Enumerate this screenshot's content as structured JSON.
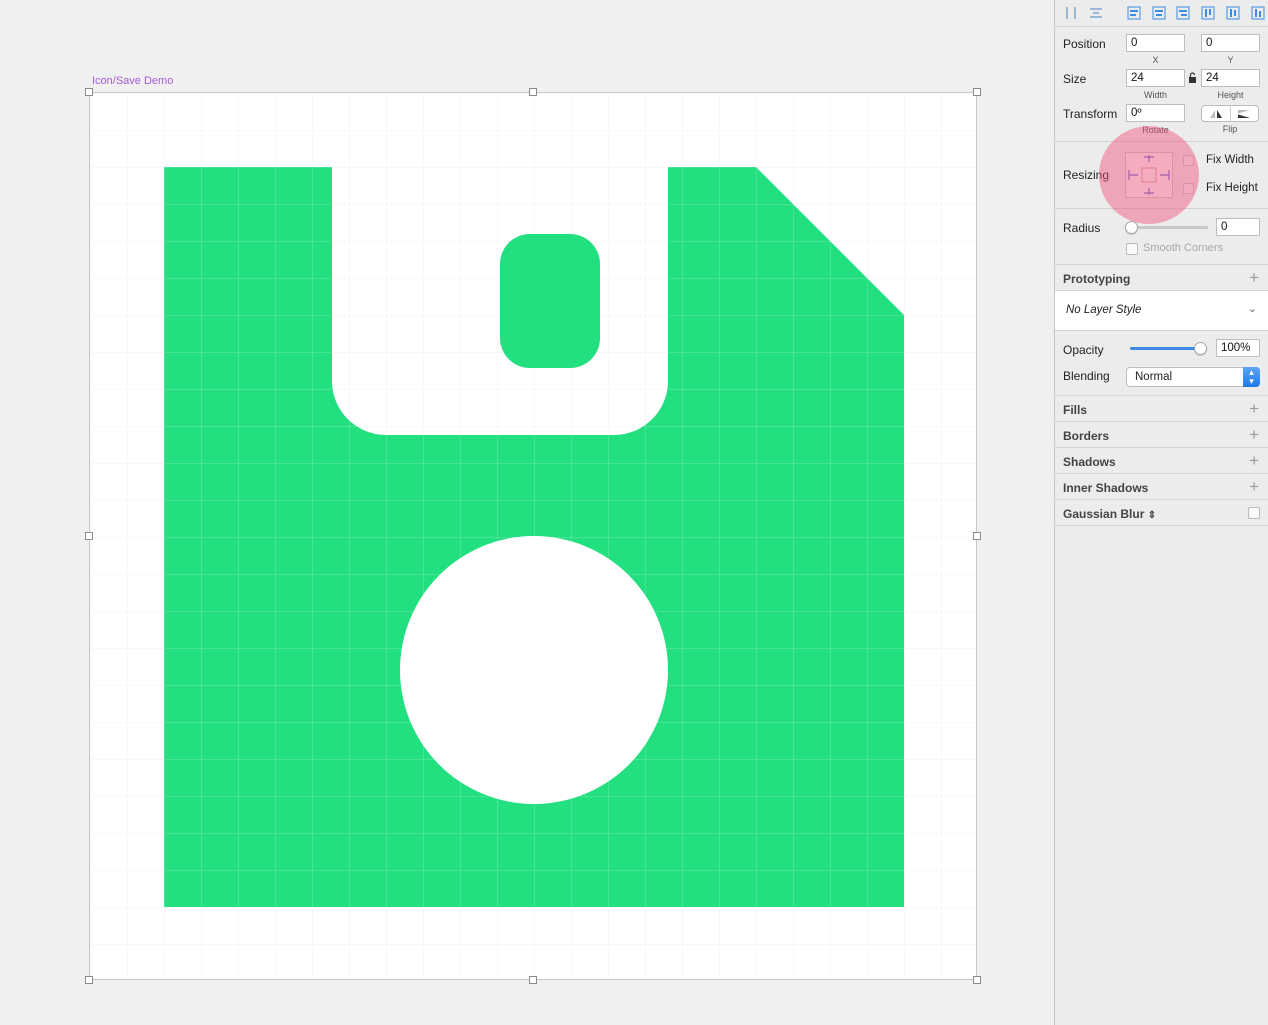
{
  "canvas": {
    "artboard_label": "Icon/Save Demo",
    "icon_color": "#22df80"
  },
  "inspector": {
    "position": {
      "label": "Position",
      "x_value": "0",
      "y_value": "0",
      "x_caption": "X",
      "y_caption": "Y"
    },
    "size": {
      "label": "Size",
      "width_value": "24",
      "height_value": "24",
      "width_caption": "Width",
      "height_caption": "Height"
    },
    "transform": {
      "label": "Transform",
      "rotate_value": "0º",
      "rotate_caption": "Rotate",
      "flip_caption": "Flip"
    },
    "resizing": {
      "label": "Resizing",
      "fix_width": "Fix Width",
      "fix_height": "Fix Height"
    },
    "radius": {
      "label": "Radius",
      "value": "0",
      "smooth_corners": "Smooth Corners"
    },
    "prototyping": {
      "title": "Prototyping"
    },
    "layer_style": {
      "value": "No Layer Style"
    },
    "opacity": {
      "label": "Opacity",
      "value": "100%",
      "level": 1.0
    },
    "blending": {
      "label": "Blending",
      "value": "Normal"
    },
    "sections": [
      {
        "title": "Fills"
      },
      {
        "title": "Borders"
      },
      {
        "title": "Shadows"
      },
      {
        "title": "Inner Shadows"
      }
    ],
    "gaussian_blur": {
      "title": "Gaussian Blur"
    }
  }
}
